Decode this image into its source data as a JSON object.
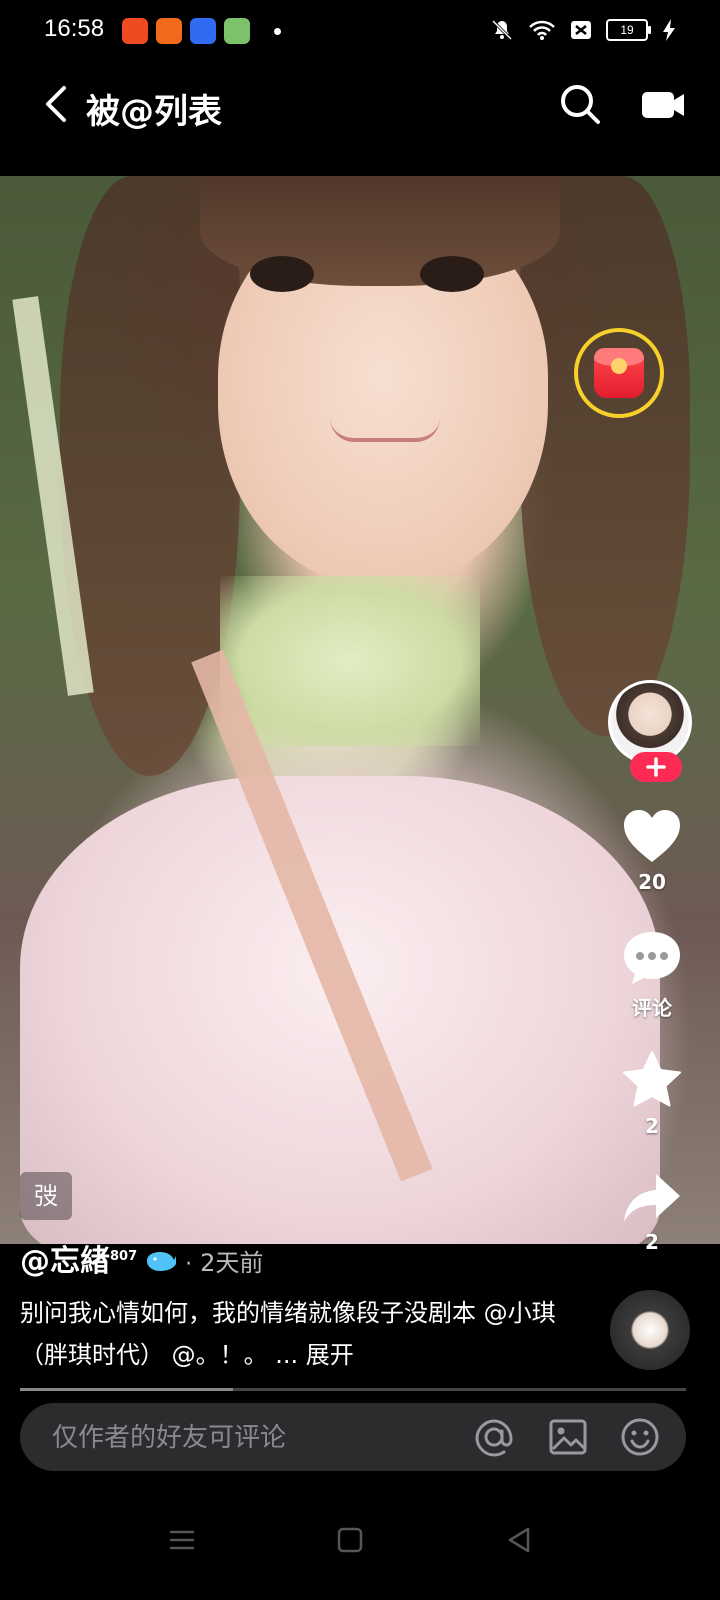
{
  "status_bar": {
    "time": "16:58",
    "battery": "19"
  },
  "header": {
    "title": "被@列表"
  },
  "video": {
    "watermark_char": "弢"
  },
  "actions": {
    "like_count": "20",
    "comment_label": "评论",
    "favorite_count": "2",
    "share_count": "2"
  },
  "post": {
    "author": "@忘緖",
    "author_sup": "807",
    "separator": "·",
    "time_ago": "2天前",
    "caption_text": "别问我心情如何，我的情绪就像段子没剧本 ",
    "mention_1": "@小琪（胖琪时代）",
    "mention_2": "@。！。",
    "expand_label": "... 展开"
  },
  "progress": {
    "fraction": 0.32
  },
  "comment": {
    "placeholder": "仅作者的好友可评论"
  },
  "colors": {
    "follow": "#fe2c55",
    "redpacket_ring": "#f7d12a"
  }
}
